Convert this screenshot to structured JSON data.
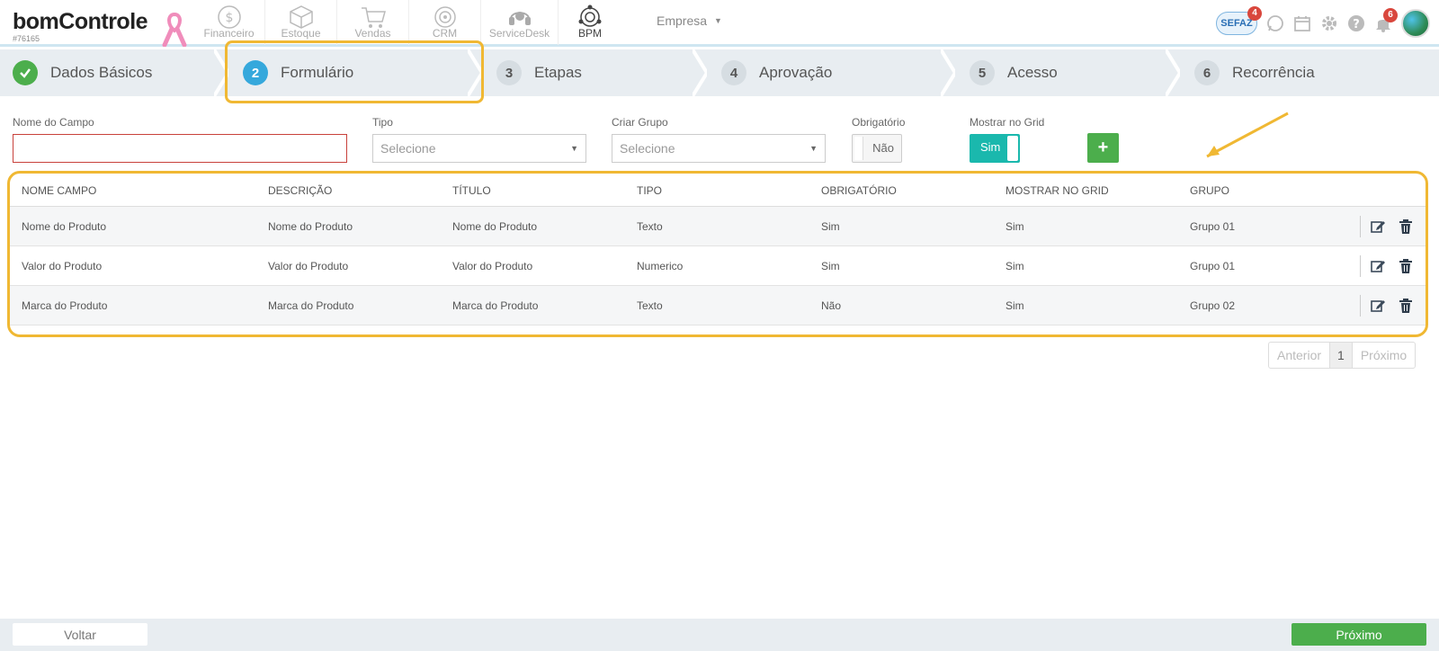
{
  "header": {
    "logo": "bomControle",
    "account_id": "#76165",
    "modules": [
      {
        "label": "Financeiro",
        "icon": "dollar-coin-icon"
      },
      {
        "label": "Estoque",
        "icon": "box-icon"
      },
      {
        "label": "Vendas",
        "icon": "shopping-cart-icon"
      },
      {
        "label": "CRM",
        "icon": "target-icon"
      },
      {
        "label": "ServiceDesk",
        "icon": "headset-icon"
      },
      {
        "label": "BPM",
        "icon": "network-globe-icon"
      }
    ],
    "company_label": "Empresa",
    "sefaz_label": "SEFAZ",
    "sefaz_badge": "4",
    "notifications_badge": "6"
  },
  "steps": [
    {
      "num": "✓",
      "label": "Dados Básicos",
      "state": "done"
    },
    {
      "num": "2",
      "label": "Formulário",
      "state": "current"
    },
    {
      "num": "3",
      "label": "Etapas",
      "state": "pending"
    },
    {
      "num": "4",
      "label": "Aprovação",
      "state": "pending"
    },
    {
      "num": "5",
      "label": "Acesso",
      "state": "pending"
    },
    {
      "num": "6",
      "label": "Recorrência",
      "state": "pending"
    }
  ],
  "form": {
    "nome_label": "Nome do Campo",
    "nome_value": "",
    "tipo_label": "Tipo",
    "tipo_value": "Selecione",
    "grupo_label": "Criar Grupo",
    "grupo_value": "Selecione",
    "obrigatorio_label": "Obrigatório",
    "obrigatorio_value": "Não",
    "grid_label": "Mostrar no Grid",
    "grid_value": "Sim",
    "add_label": "+"
  },
  "table": {
    "columns": [
      "NOME CAMPO",
      "DESCRIÇÃO",
      "TÍTULO",
      "TIPO",
      "OBRIGATÓRIO",
      "MOSTRAR NO GRID",
      "GRUPO"
    ],
    "rows": [
      [
        "Nome do Produto",
        "Nome do Produto",
        "Nome do Produto",
        "Texto",
        "Sim",
        "Sim",
        "Grupo 01"
      ],
      [
        "Valor do Produto",
        "Valor do Produto",
        "Valor do Produto",
        "Numerico",
        "Sim",
        "Sim",
        "Grupo 01"
      ],
      [
        "Marca do Produto",
        "Marca do Produto",
        "Marca do Produto",
        "Texto",
        "Não",
        "Sim",
        "Grupo 02"
      ]
    ]
  },
  "pagination": {
    "prev": "Anterior",
    "current": "1",
    "next": "Próximo"
  },
  "footer": {
    "back": "Voltar",
    "next": "Próximo"
  },
  "colors": {
    "accent_green": "#4cae4c",
    "accent_blue": "#35a8dc",
    "highlight": "#f0b833",
    "toggle_on": "#1ab8ad",
    "error": "#c8413b"
  }
}
